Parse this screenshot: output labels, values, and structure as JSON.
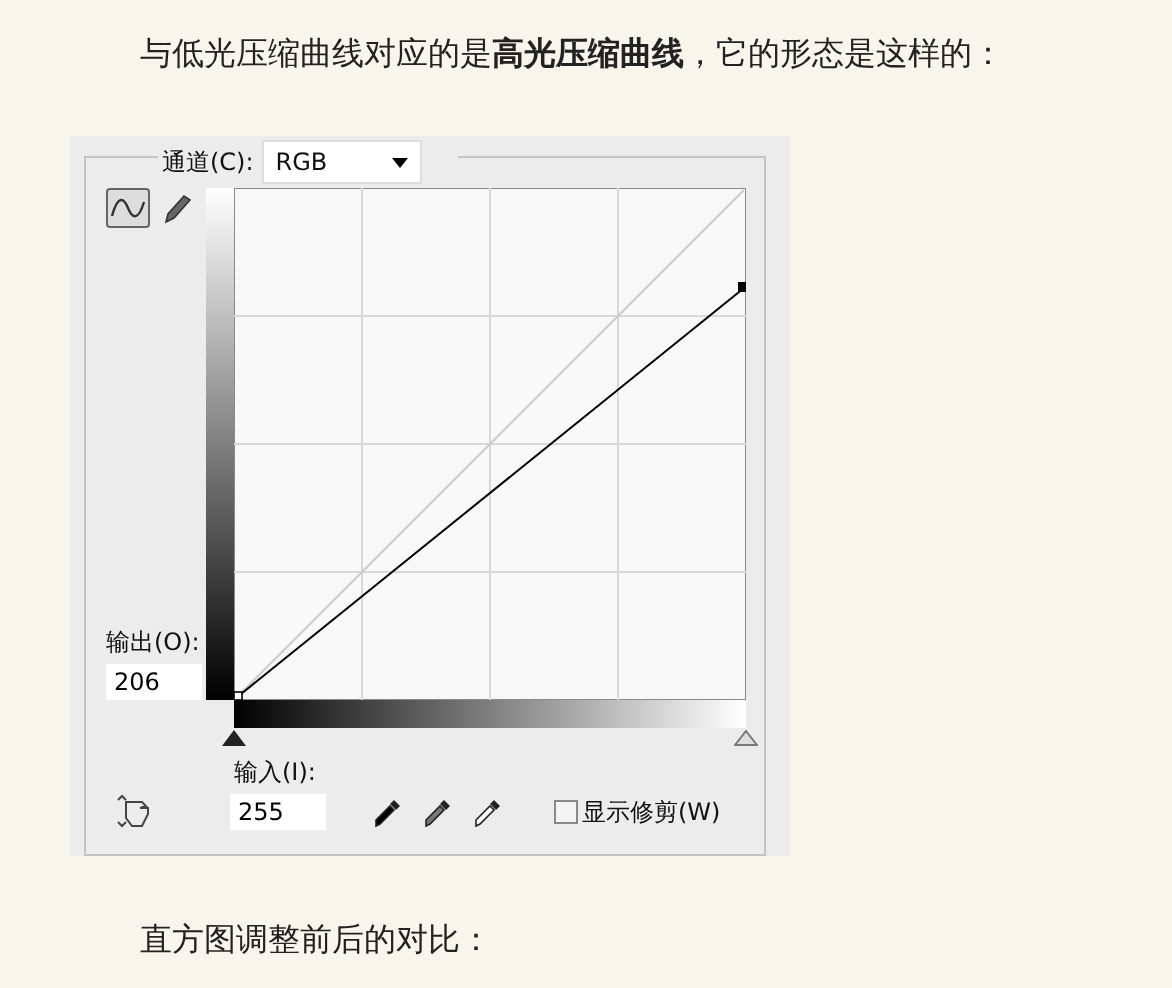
{
  "intro": "与低光压缩曲线对应的是**高光压缩曲线**，它的形态是这样的：",
  "curves_dialog": {
    "channel_label": "通道(C):",
    "channel_value": "RGB",
    "tools": [
      {
        "kind": "curve",
        "selected": true
      },
      {
        "kind": "pencil",
        "selected": false
      }
    ],
    "output_label": "输出(O):",
    "output_value": "206",
    "input_label": "输入(I):",
    "input_value": "255",
    "show_clipping": {
      "label": "显示修剪(W)",
      "checked": false
    }
  },
  "caption": "直方图调整前后的对比："
}
